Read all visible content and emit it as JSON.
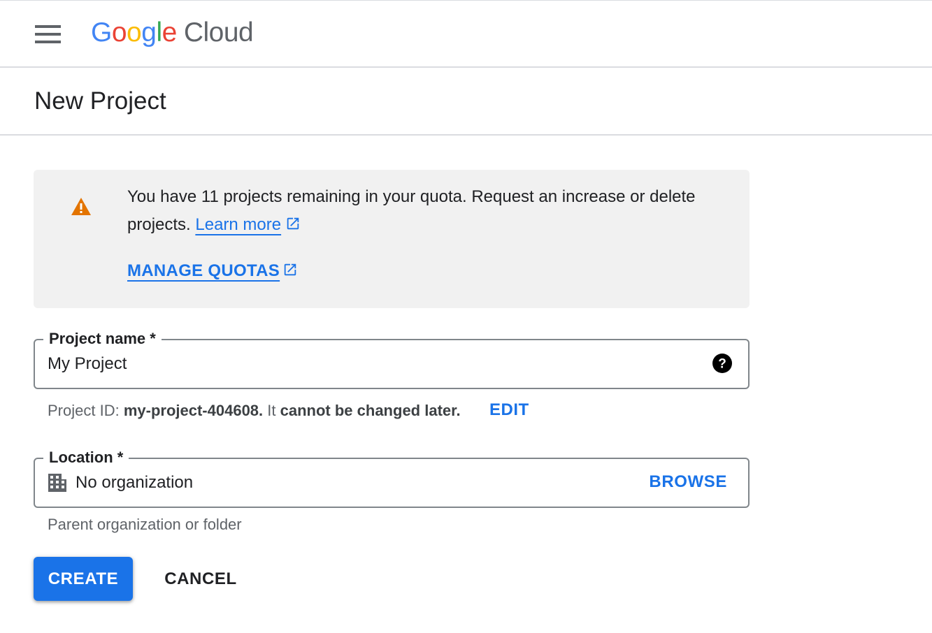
{
  "header": {
    "logo_brand": "Google",
    "logo_product": "Cloud",
    "menu_icon": "hamburger-menu-icon"
  },
  "page": {
    "title": "New Project"
  },
  "notice": {
    "icon": "warning-icon",
    "icon_color": "#e37400",
    "message": "You have 11 projects remaining in your quota. Request an increase or delete projects.",
    "learn_more": "Learn more",
    "manage_quotas": "MANAGE QUOTAS"
  },
  "project_name": {
    "label": "Project name *",
    "value": "My Project",
    "help_icon": "help-circle-icon"
  },
  "project_id": {
    "prefix": "Project ID:",
    "id": "my-project-404608.",
    "middle": "It",
    "suffix": "cannot be changed later.",
    "edit_label": "EDIT"
  },
  "location": {
    "label": "Location *",
    "value": "No organization",
    "icon": "organization-building-icon",
    "browse_label": "BROWSE",
    "hint": "Parent organization or folder"
  },
  "actions": {
    "create_label": "CREATE",
    "cancel_label": "CANCEL"
  },
  "colors": {
    "accent": "#1a73e8",
    "warning": "#e37400"
  }
}
